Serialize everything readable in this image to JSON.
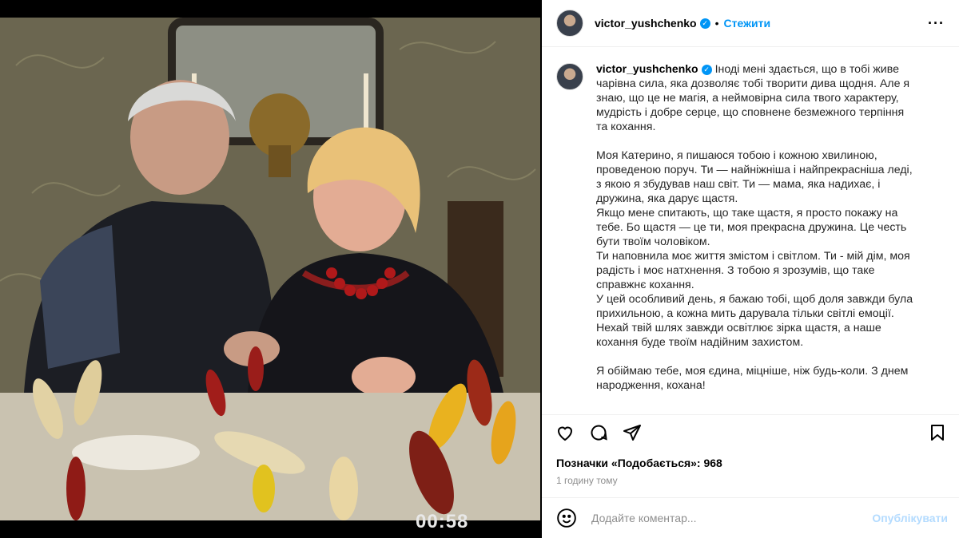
{
  "header": {
    "username": "victor_yushchenko",
    "verified_icon": "verified-check-icon",
    "separator": "•",
    "follow_label": "Стежити",
    "more_icon": "more-options-icon"
  },
  "photo": {
    "overlay_time": "00:58"
  },
  "caption": {
    "username": "victor_yushchenko",
    "p1": "Іноді мені здається, що в тобі живе чарівна сила, яка дозволяє тобі творити дива щодня. Але я знаю, що це не магія, а неймовірна сила твого характеру, мудрість і добре серце, що сповнене безмежного терпіння та кохання.",
    "p2": "Моя Катерино, я пишаюся тобою і кожною хвилиною, проведеною поруч. Ти — найніжніша і найпрекрасніша леді, з якою я збудував наш світ. Ти — мама, яка надихає, і дружина, яка дарує щастя.\nЯкщо мене спитають, що таке щастя, я просто покажу на тебе. Бо щастя — це ти, моя прекрасна дружина. Це честь бути твоїм чоловіком.\nТи наповнила моє життя змістом і світлом. Ти - мій дім, моя радість і моє натхнення. З тобою я зрозумів, що таке справжнє кохання.\nУ цей особливий день, я бажаю тобі, щоб доля завжди була прихильною, а кожна мить дарувала тільки світлі емоції.\nНехай твій шлях завжди освітлює зірка щастя, а наше кохання буде твоїм надійним захистом.",
    "p3": "Я обіймаю тебе, моя єдина, міцніше, ніж будь-коли. З днем народження, кохана!"
  },
  "actions": {
    "like_icon": "heart-icon",
    "comment_icon": "comment-bubble-icon",
    "share_icon": "paper-plane-icon",
    "save_icon": "bookmark-icon"
  },
  "likes_text": "Позначки «Подобається»: 968",
  "time_ago": "1 годину тому",
  "comment": {
    "emoji_icon": "smiley-icon",
    "placeholder": "Додайте коментар...",
    "publish_label": "Опублікувати"
  },
  "colors": {
    "accent": "#0095f6",
    "publish_disabled": "#b3dbff",
    "muted": "#8e8e8e"
  }
}
